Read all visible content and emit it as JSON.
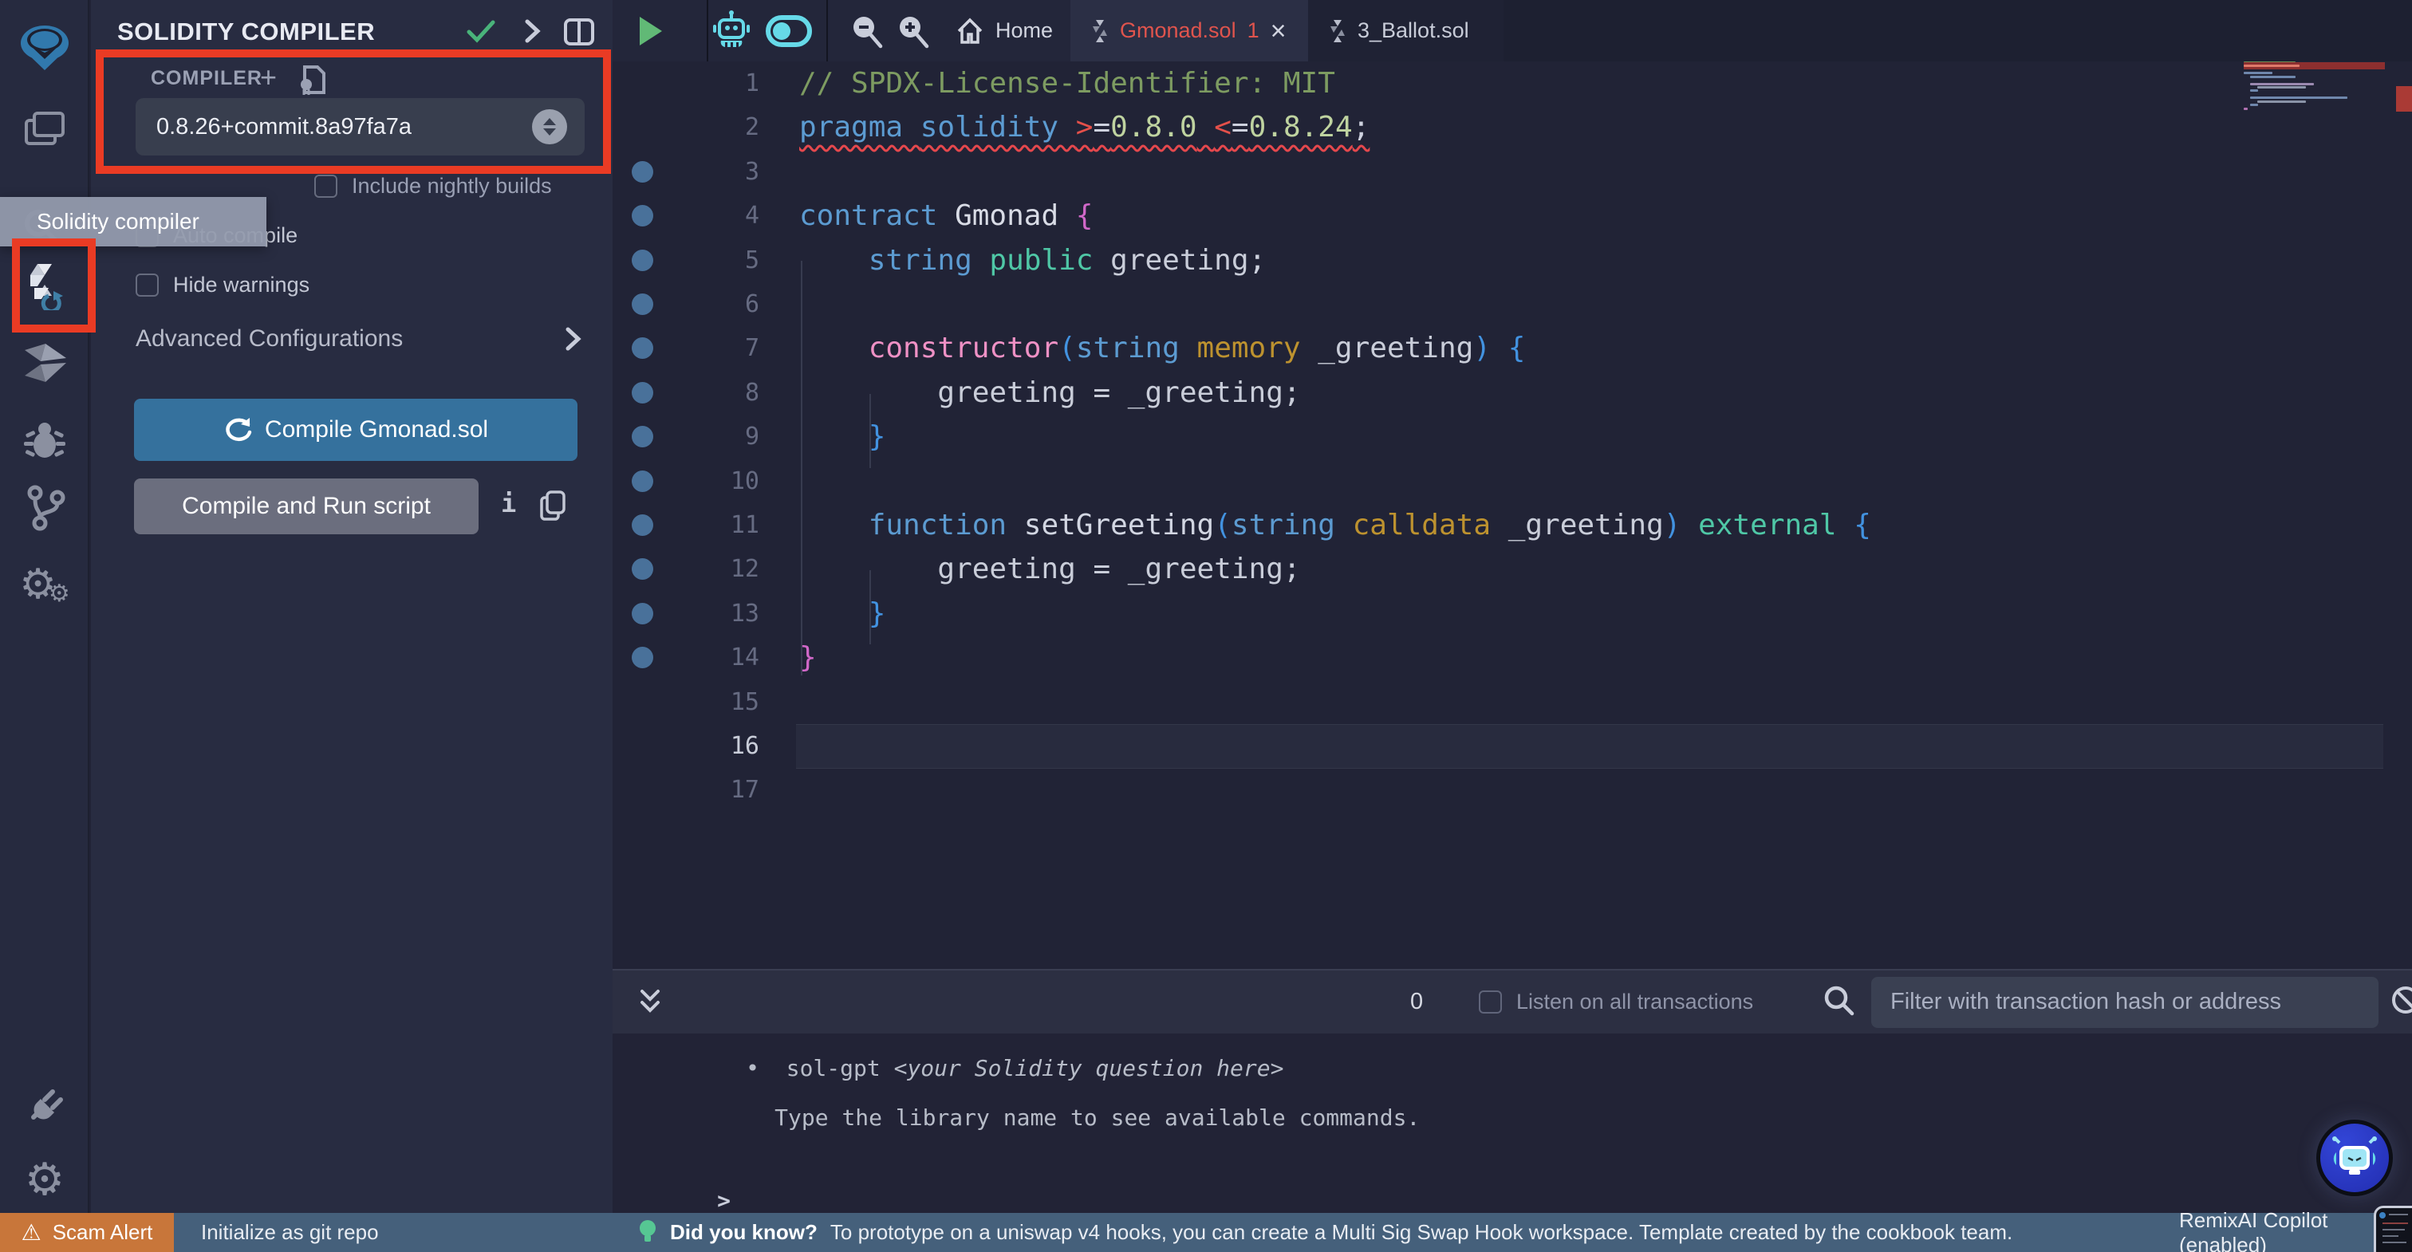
{
  "colors": {
    "annotation_red": "#ea3b24",
    "accent_blue_button": "#35719d",
    "statusbar_blue": "#45607b",
    "scam_alert_orange": "#c8763a",
    "active_icon_cyan": "#66d9e8",
    "run_green": "#61b976",
    "error_tab_red": "#e0544d",
    "breakpoint_dot": "#49719a"
  },
  "tooltip": {
    "text": "Solidity compiler"
  },
  "side_panel": {
    "title": "SOLIDITY COMPILER",
    "compiler_section_label": "COMPILER",
    "compiler_version": "0.8.26+commit.8a97fa7a",
    "checkboxes": [
      {
        "label": "Include nightly builds",
        "checked": false
      },
      {
        "label": "Auto compile",
        "checked": false
      },
      {
        "label": "Hide warnings",
        "checked": false
      }
    ],
    "advanced_configurations_label": "Advanced Configurations",
    "compile_button_label": "Compile Gmonad.sol",
    "compile_run_button_label": "Compile and Run script"
  },
  "editor": {
    "tabs": [
      {
        "label": "Home"
      },
      {
        "label": "Gmonad.sol",
        "badge": "1",
        "active": true
      },
      {
        "label": "3_Ballot.sol"
      }
    ],
    "active_line": 16,
    "syntax_palette": {
      "comment": "#7d9b61",
      "kw": "#5c9bd1",
      "err": "#e5504a",
      "op": "#cdd1de",
      "num": "#bfd3a0",
      "ident": "#d9dce6",
      "b1": "#d168c9",
      "b2": "#4292e0",
      "mod": "#4fc7a6",
      "var": "#c9cdd9",
      "ctor": "#ef91c5",
      "loc": "#bd922f",
      "fn": "#d2d6e2"
    },
    "lines": [
      {
        "n": 1,
        "dot": false,
        "tokens": [
          [
            "// SPDX-License-Identifier: MIT",
            "comment"
          ]
        ]
      },
      {
        "n": 2,
        "dot": false,
        "squiggle": true,
        "tokens": [
          [
            "pragma ",
            "kw"
          ],
          [
            "solidity ",
            "kw"
          ],
          [
            ">",
            "err"
          ],
          [
            "=",
            "op"
          ],
          [
            "0.8.0",
            "num"
          ],
          [
            " ",
            "op"
          ],
          [
            "<",
            "err"
          ],
          [
            "=",
            "op"
          ],
          [
            "0.8.24",
            "num"
          ],
          [
            ";",
            "op"
          ]
        ]
      },
      {
        "n": 3,
        "dot": true,
        "tokens": []
      },
      {
        "n": 4,
        "dot": true,
        "tokens": [
          [
            "contract ",
            "kw"
          ],
          [
            "Gmonad ",
            "ident"
          ],
          [
            "{",
            "b1"
          ]
        ]
      },
      {
        "n": 5,
        "dot": true,
        "tokens": [
          [
            "    ",
            "op"
          ],
          [
            "string ",
            "kw"
          ],
          [
            "public ",
            "mod"
          ],
          [
            "greeting",
            "var"
          ],
          [
            ";",
            "op"
          ]
        ]
      },
      {
        "n": 6,
        "dot": true,
        "tokens": []
      },
      {
        "n": 7,
        "dot": true,
        "tokens": [
          [
            "    ",
            "op"
          ],
          [
            "constructor",
            "ctor"
          ],
          [
            "(",
            "b2"
          ],
          [
            "string ",
            "kw"
          ],
          [
            "memory ",
            "loc"
          ],
          [
            "_greeting",
            "var"
          ],
          [
            ") ",
            "b2"
          ],
          [
            "{",
            "b2"
          ]
        ]
      },
      {
        "n": 8,
        "dot": true,
        "tokens": [
          [
            "        greeting = _greeting;",
            "var"
          ]
        ]
      },
      {
        "n": 9,
        "dot": true,
        "tokens": [
          [
            "    ",
            "op"
          ],
          [
            "}",
            "b2"
          ]
        ]
      },
      {
        "n": 10,
        "dot": true,
        "tokens": []
      },
      {
        "n": 11,
        "dot": true,
        "tokens": [
          [
            "    ",
            "op"
          ],
          [
            "function ",
            "kw"
          ],
          [
            "setGreeting",
            "fn"
          ],
          [
            "(",
            "b2"
          ],
          [
            "string ",
            "kw"
          ],
          [
            "calldata ",
            "loc"
          ],
          [
            "_greeting",
            "var"
          ],
          [
            ") ",
            "b2"
          ],
          [
            "external ",
            "mod"
          ],
          [
            "{",
            "b2"
          ]
        ]
      },
      {
        "n": 12,
        "dot": true,
        "tokens": [
          [
            "        greeting = _greeting;",
            "var"
          ]
        ]
      },
      {
        "n": 13,
        "dot": true,
        "tokens": [
          [
            "    ",
            "op"
          ],
          [
            "}",
            "b2"
          ]
        ]
      },
      {
        "n": 14,
        "dot": true,
        "tokens": [
          [
            "}",
            "b1"
          ]
        ]
      },
      {
        "n": 15,
        "dot": false,
        "tokens": []
      },
      {
        "n": 16,
        "dot": false,
        "tokens": []
      },
      {
        "n": 17,
        "dot": false,
        "tokens": []
      }
    ]
  },
  "minimap": {
    "error_line": 2,
    "rows": [
      {
        "n": 1,
        "indent": 0,
        "w": 65,
        "color": "#6d8d55"
      },
      {
        "n": 2,
        "indent": 0,
        "w": 70,
        "color": "#e07a6a",
        "errbg": true
      },
      {
        "n": 4,
        "indent": 0,
        "w": 36,
        "color": "#6f87ac"
      },
      {
        "n": 5,
        "indent": 8,
        "w": 57,
        "color": "#6f87ac"
      },
      {
        "n": 7,
        "indent": 8,
        "w": 80,
        "color": "#9b89b0"
      },
      {
        "n": 8,
        "indent": 17,
        "w": 61,
        "color": "#8a93a8"
      },
      {
        "n": 9,
        "indent": 8,
        "w": 10,
        "color": "#6f87ac"
      },
      {
        "n": 11,
        "indent": 8,
        "w": 122,
        "color": "#6f87ac"
      },
      {
        "n": 12,
        "indent": 17,
        "w": 61,
        "color": "#8a93a8"
      },
      {
        "n": 13,
        "indent": 8,
        "w": 10,
        "color": "#6f87ac"
      },
      {
        "n": 14,
        "indent": 0,
        "w": 5,
        "color": "#b070b0"
      }
    ]
  },
  "terminal": {
    "badge_count": "0",
    "listen_label": "Listen on all transactions",
    "filter_placeholder": "Filter with transaction hash or address",
    "bullet": "•",
    "line1_cmd": "sol-gpt ",
    "line1_hint": "<your Solidity question here>",
    "line2": "Type the library name to see available commands.",
    "prompt": ">"
  },
  "status_bar": {
    "scam_alert_label": "Scam Alert",
    "git_label": "Initialize as git repo",
    "did_you_know_label": "Did you know?",
    "tip_text": "To prototype on a uniswap v4 hooks, you can create a Multi Sig Swap Hook workspace. Template created by the cookbook team.",
    "copilot_label": "RemixAI Copilot (enabled)"
  }
}
